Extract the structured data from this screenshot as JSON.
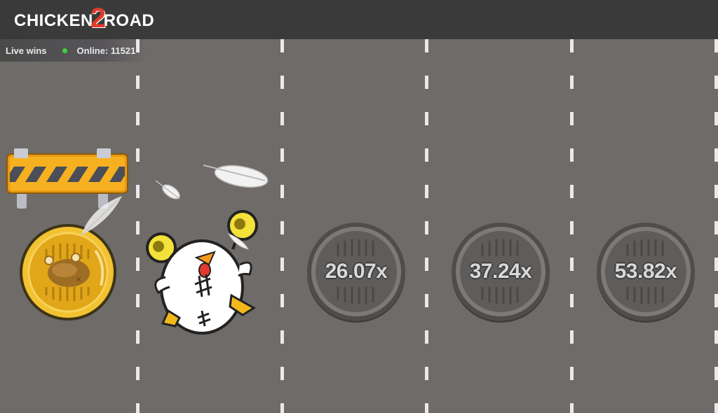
{
  "header": {
    "logo_part1": "CHICKEN",
    "logo_two": "2",
    "logo_part2": "ROAD"
  },
  "status": {
    "live_wins_label": "Live wins",
    "online_text": "Online: 11521"
  },
  "lanes": [
    {
      "multiplier": "26.07x"
    },
    {
      "multiplier": "37.24x"
    },
    {
      "multiplier": "53.82x"
    }
  ],
  "colors": {
    "road": "#6e6b69",
    "topbar": "#3a3a3a",
    "online_dot": "#3ed43e",
    "logo_accent": "#e33a2c",
    "gold": "#f2c230"
  }
}
